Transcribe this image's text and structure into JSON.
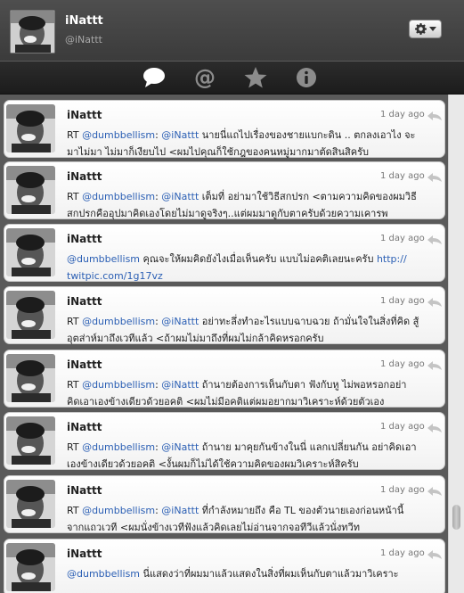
{
  "header": {
    "name": "iNattt",
    "handle": "@iNattt"
  },
  "tabs": [
    {
      "icon": "speech-bubble-icon"
    },
    {
      "icon": "at-sign-icon"
    },
    {
      "icon": "star-icon"
    },
    {
      "icon": "info-icon"
    }
  ],
  "tweets": [
    {
      "author": "iNattt",
      "time": "1 day ago",
      "line1_prefix": "RT ",
      "mention1": "@dumbbellism",
      "mention2": "@iNattt",
      "line1_rest": " นายนี่แถไปเรื่องของชายแบกะดิน .. ตกลงเอาไง จะ",
      "line2": "มาไม่มา ไม่มาก็เงียบไป <ผมไปคุณก็ใช้กฎของคนหมู่มากมาตัดสินสิครับ"
    },
    {
      "author": "iNattt",
      "time": "1 day ago",
      "line1_prefix": "RT ",
      "mention1": "@dumbbellism",
      "mention2": "@iNattt",
      "line1_rest": " เต็มที่ อย่ามาใช้วิธีสกปรก <ตามความคิดของผมวิธี",
      "line2": "สกปรกคืออุปมาคิดเองโดยไม่มาดูจริงๆ..แต่ผมมาดูกับตาครับด้วยความเคารพ"
    },
    {
      "author": "iNattt",
      "time": "1 day ago",
      "line1_prefix": "",
      "mention1": "@dumbbellism",
      "mention2": "",
      "line1_rest": " คุณจะให้ผมคิดยังไงเมื่อเห็นครับ แบบไม่อคติเลยนะครับ ",
      "link1": "http://",
      "line2": "",
      "link2": "twitpic.com/1g17vz"
    },
    {
      "author": "iNattt",
      "time": "1 day ago",
      "line1_prefix": "RT ",
      "mention1": "@dumbbellism",
      "mention2": "@iNattt",
      "line1_rest": " อย่าทะลึ่งทำอะไรแบบฉาบฉวย ถ้ามั่นใจในสิ่งที่คิด สู้",
      "line2": "อุตส่าห์มาถึงเวทีแล้ว <ถ้าผมไม่มาถึงที่ผมไม่กล้าคิดหรอกครับ"
    },
    {
      "author": "iNattt",
      "time": "1 day ago",
      "line1_prefix": "RT ",
      "mention1": "@dumbbellism",
      "mention2": "@iNattt",
      "line1_rest": " ถ้านายต้องการเห็นกับตา ฟังกับหู ไม่พอหรอกอย่า",
      "line2": "คิดเอาเองข้างเดียวด้วยอคติ <ผมไม่มีอคติแต่ผมอยากมาวิเคราะห์ด้วยตัวเอง"
    },
    {
      "author": "iNattt",
      "time": "1 day ago",
      "line1_prefix": "RT ",
      "mention1": "@dumbbellism",
      "mention2": "@iNattt",
      "line1_rest": " ถ้านาย มาคุยกันข้างในนี่ แลกเปลี่ยนกัน อย่าคิดเอา",
      "line2": "เองข้างเดียวด้วยอคติ <งั้นผมก็ไม่ได้ใช้ความคิดของผมวิเคราะห์สิครับ"
    },
    {
      "author": "iNattt",
      "time": "1 day ago",
      "line1_prefix": "RT ",
      "mention1": "@dumbbellism",
      "mention2": "@iNattt",
      "line1_rest": " ที่กำลังหมายถึง คือ TL ของตัวนายเองก่อนหน้านี้",
      "line2": "จากแถวเวที <ผมนั่งข้างเวทีฟังแล้วคิดเลยไม่อ่านจากจอทีวีแล้วนั่งทวีท"
    },
    {
      "author": "iNattt",
      "time": "1 day ago",
      "line1_prefix": "",
      "mention1": "@dumbbellism",
      "mention2": "",
      "line1_rest": " นี่แสดงว่าที่ผมมาแล้วแสดงในสิ่งที่ผมเห็นกับตาแล้วมาวิเคราะ",
      "line2": ""
    }
  ]
}
